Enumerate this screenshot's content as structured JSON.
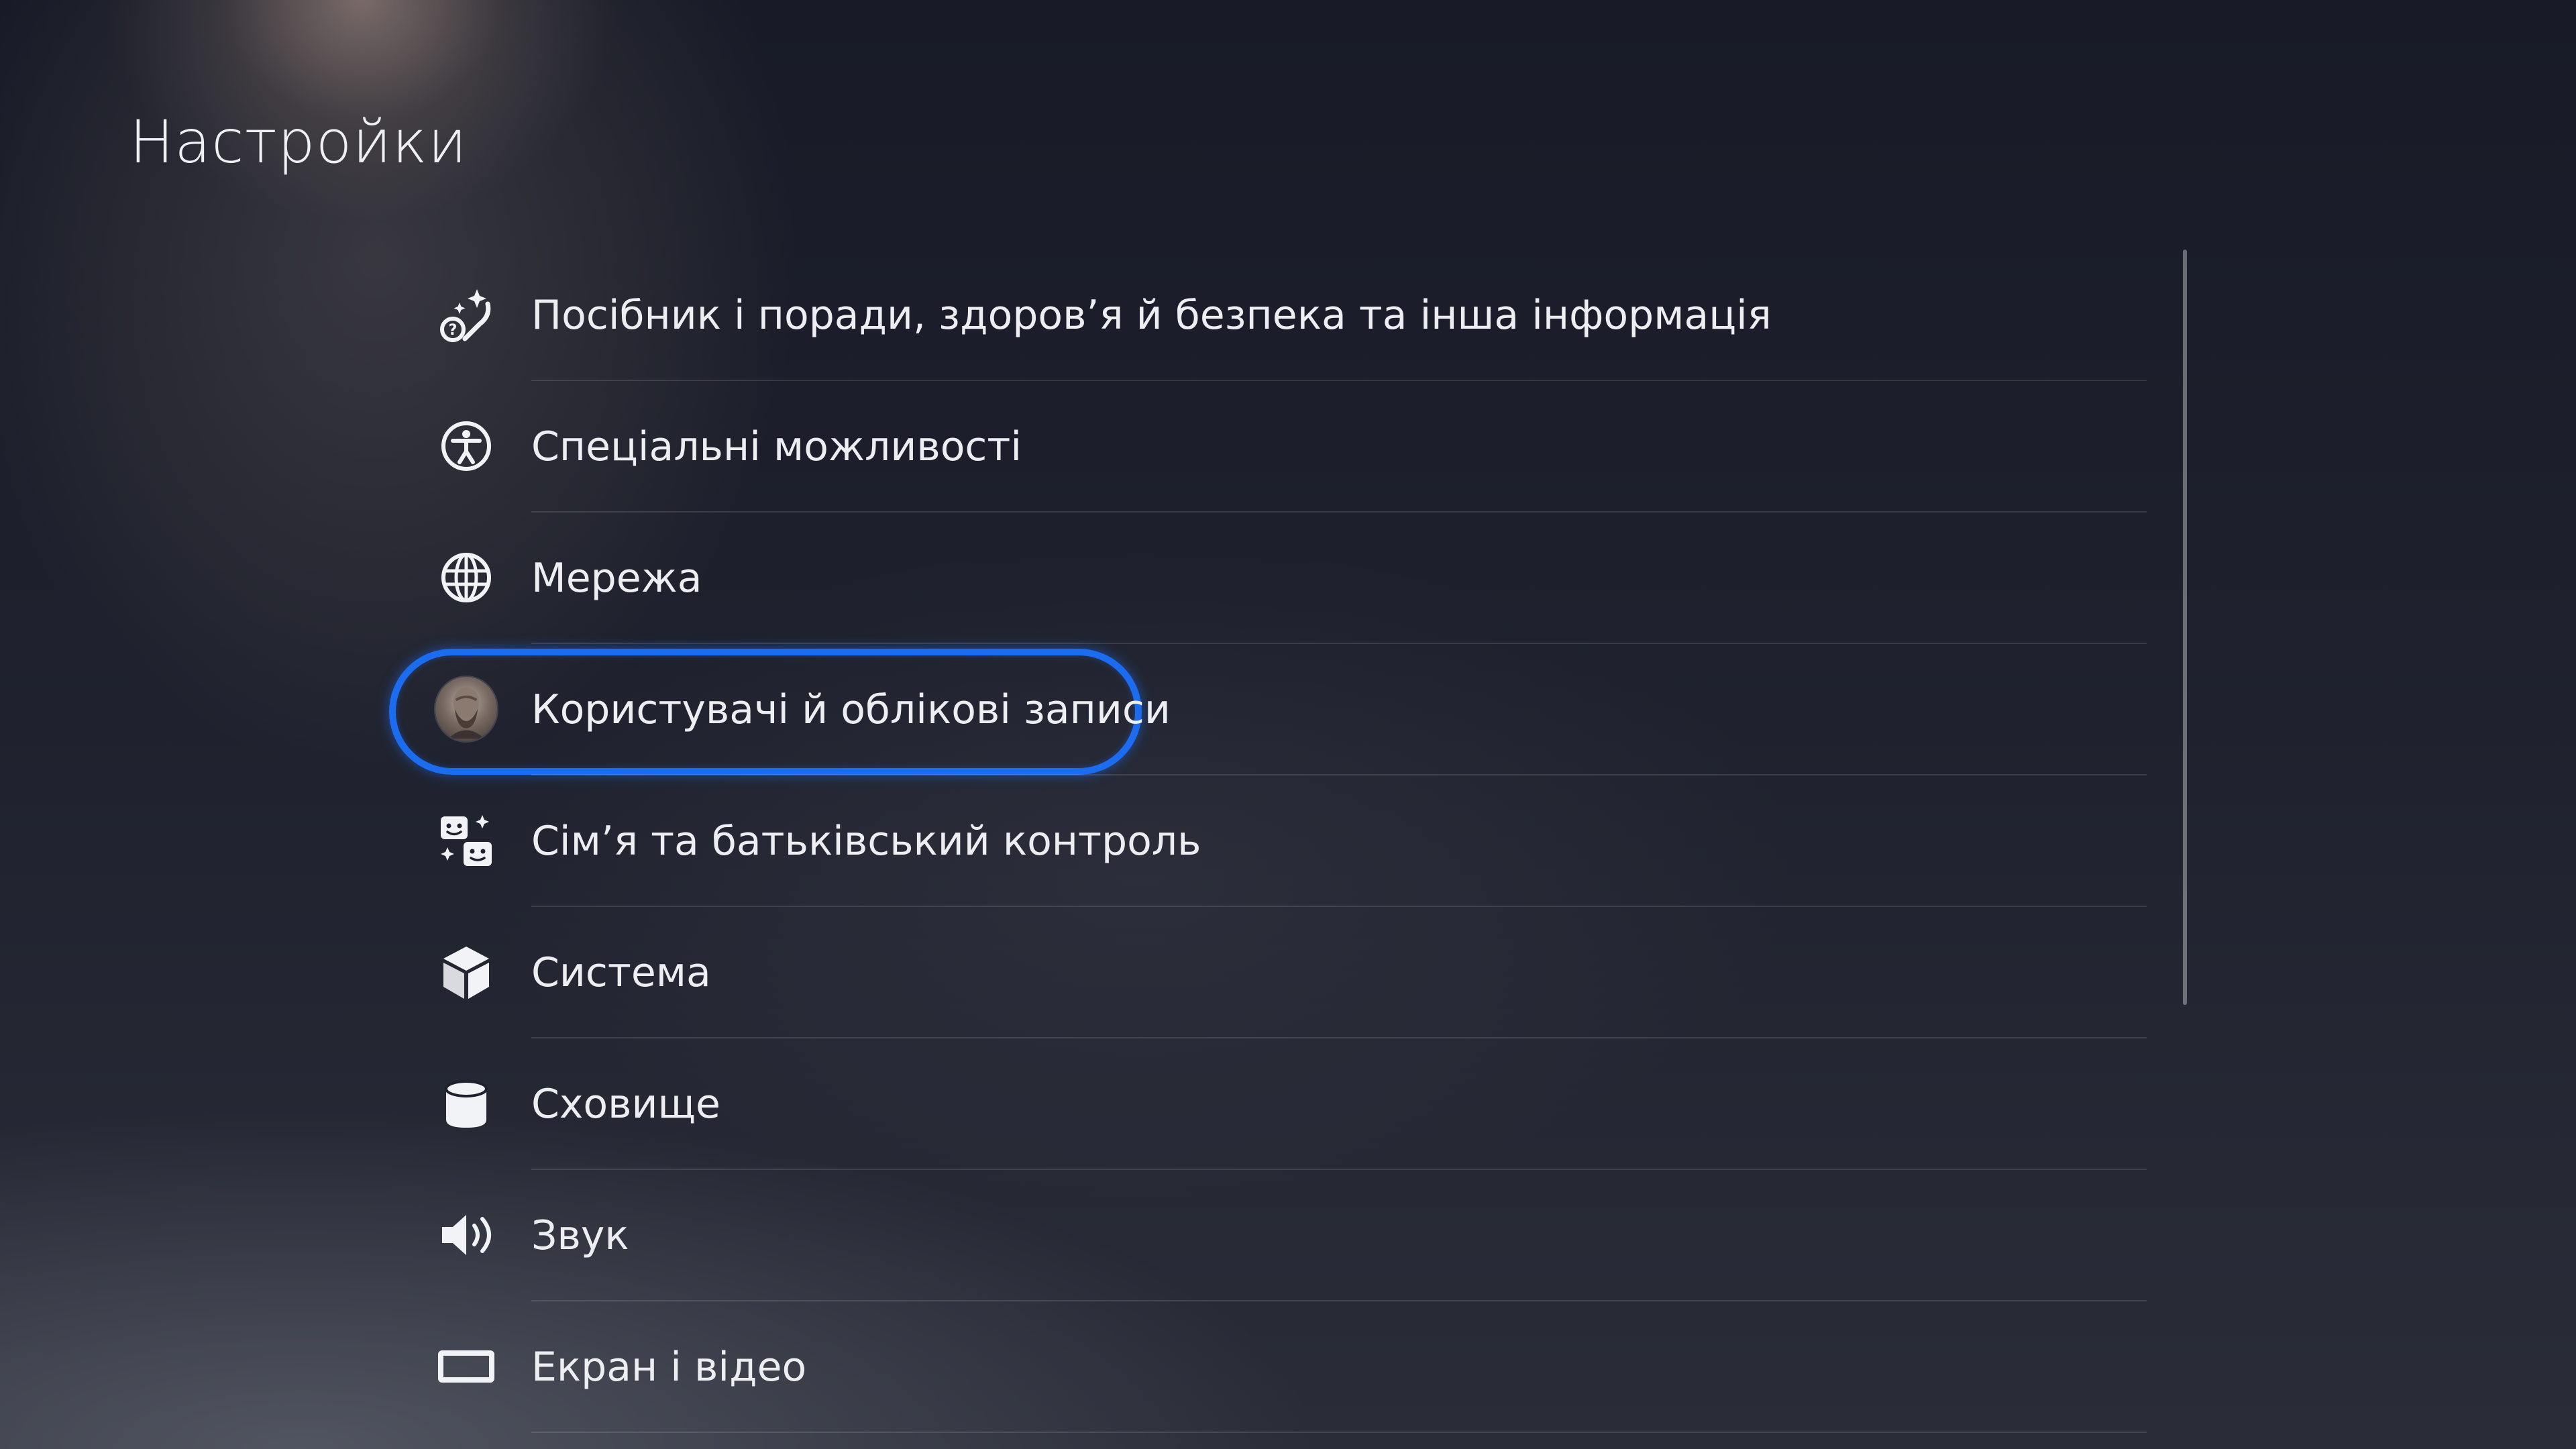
{
  "header": {
    "title": "Настройки"
  },
  "menu": {
    "items": [
      {
        "label": "Посібник і поради, здоров’я й безпека та інша інформація",
        "icon": "guide-sparkle-icon"
      },
      {
        "label": "Спеціальні можливості",
        "icon": "accessibility-icon"
      },
      {
        "label": "Мережа",
        "icon": "globe-icon"
      },
      {
        "label": "Користувачі й облікові записи",
        "icon": "user-avatar",
        "focused": true
      },
      {
        "label": "Сім’я та батьківський контроль",
        "icon": "family-icon"
      },
      {
        "label": "Система",
        "icon": "cube-icon"
      },
      {
        "label": "Сховище",
        "icon": "storage-cylinder-icon"
      },
      {
        "label": "Звук",
        "icon": "speaker-icon"
      },
      {
        "label": "Екран і відео",
        "icon": "screen-icon"
      }
    ]
  },
  "colors": {
    "focus_ring": "#1c6cf0",
    "text": "#eceef2",
    "background": "#1e212d"
  }
}
